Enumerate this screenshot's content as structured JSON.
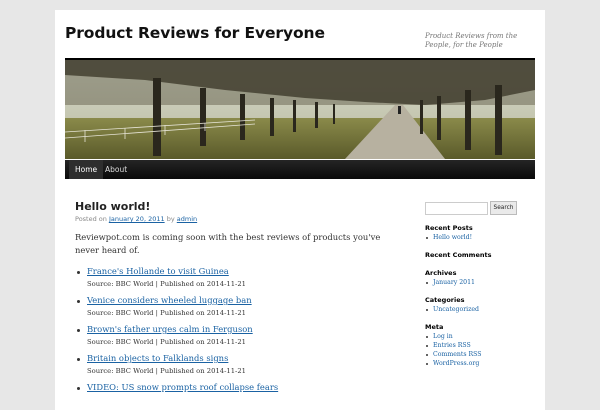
{
  "site": {
    "title": "Product Reviews for Everyone",
    "description": "Product Reviews from the People, for the People"
  },
  "nav": [
    {
      "label": "Home"
    },
    {
      "label": "About"
    }
  ],
  "post": {
    "title": "Hello world!",
    "meta_posted_on": "Posted on",
    "meta_date": "January 20, 2011",
    "meta_by": "by",
    "meta_author": "admin",
    "intro": "Reviewpot.com is coming soon with the best reviews of products you've never heard of.",
    "news": [
      {
        "headline": "France's Hollande to visit Guinea",
        "source": "Source: BBC World | Published on 2014-11-21"
      },
      {
        "headline": "Venice considers wheeled luggage ban",
        "source": "Source: BBC World | Published on 2014-11-21"
      },
      {
        "headline": "Brown's father urges calm in Ferguson",
        "source": "Source: BBC World | Published on 2014-11-21"
      },
      {
        "headline": "Britain objects to Falklands signs",
        "source": "Source: BBC World | Published on 2014-11-21"
      },
      {
        "headline": "VIDEO: US snow prompts roof collapse fears",
        "source": ""
      }
    ]
  },
  "sidebar": {
    "search_button": "Search",
    "search_value": "",
    "recent_posts": {
      "title": "Recent Posts",
      "items": [
        "Hello world!"
      ]
    },
    "recent_comments": {
      "title": "Recent Comments"
    },
    "archives": {
      "title": "Archives",
      "items": [
        "January 2011"
      ]
    },
    "categories": {
      "title": "Categories",
      "items": [
        "Uncategorized"
      ]
    },
    "meta": {
      "title": "Meta",
      "items": [
        "Log in",
        "Entries RSS",
        "Comments RSS",
        "WordPress.org"
      ]
    }
  }
}
